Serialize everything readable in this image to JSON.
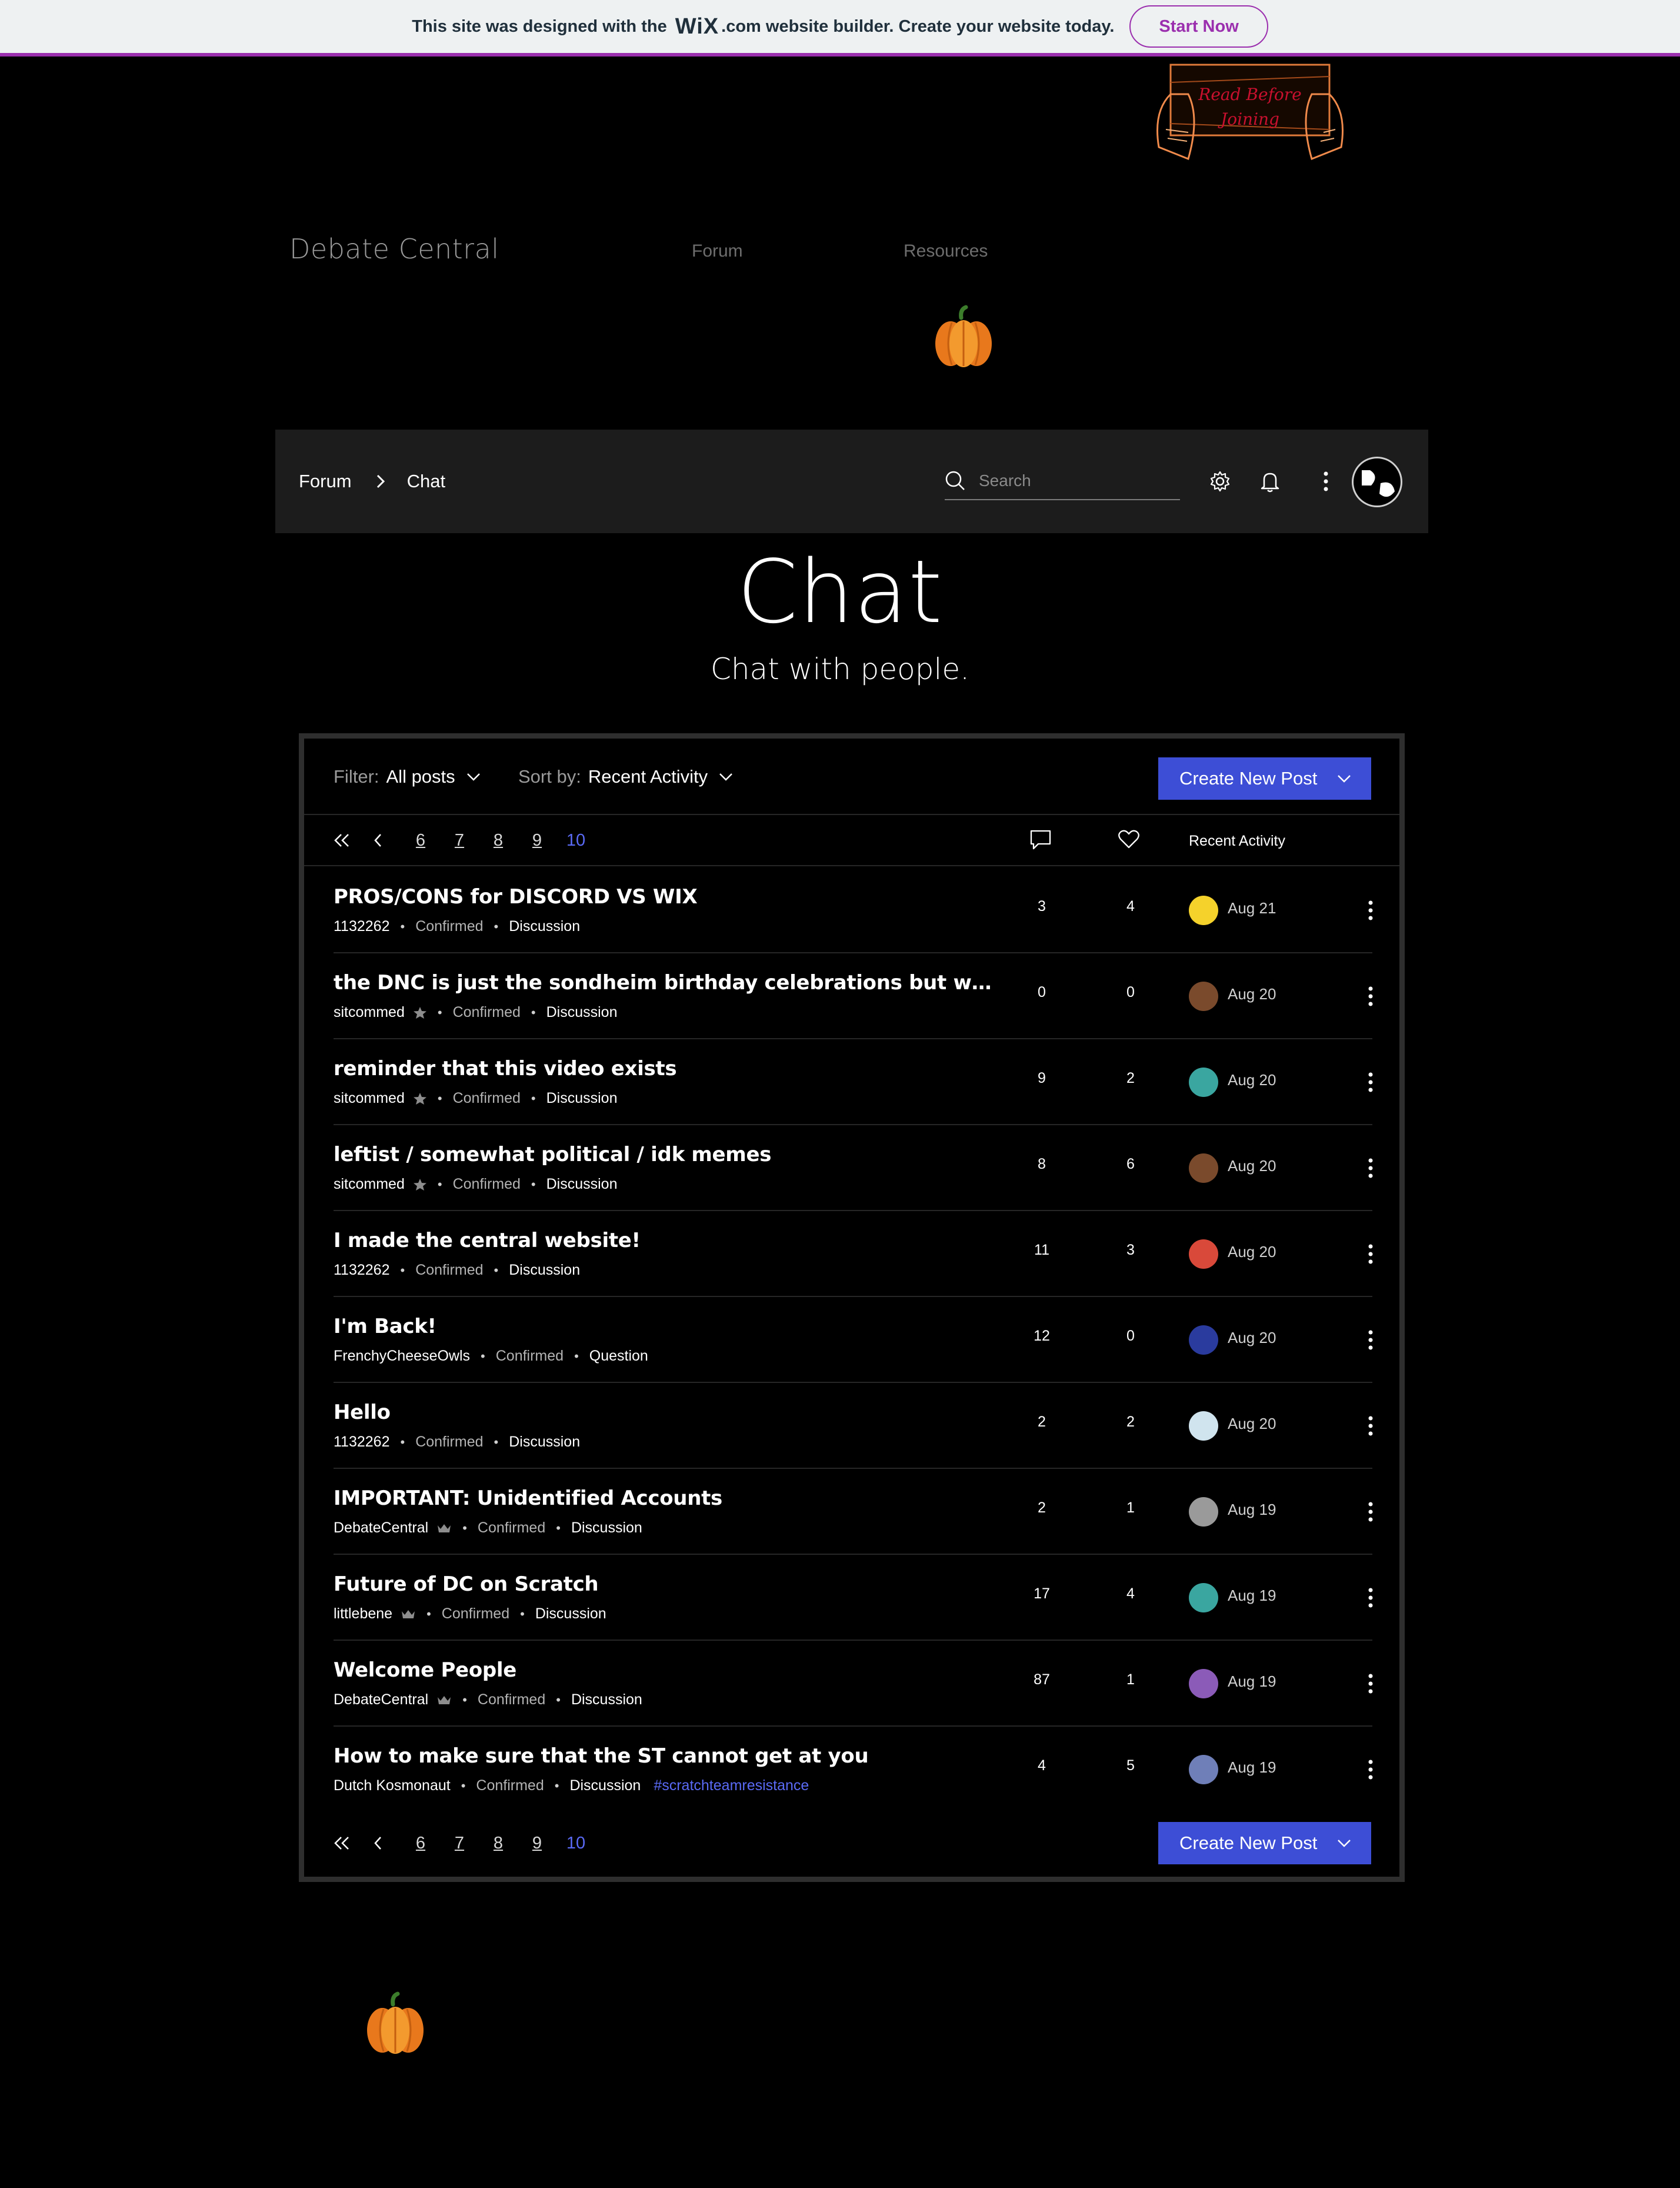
{
  "wix_banner": {
    "text_before": "This site was designed with the",
    "logo": "WiX",
    "text_after": ".com website builder. Create your website today.",
    "cta": "Start Now"
  },
  "header_art": {
    "line1": "Read Before",
    "line2": "Joining"
  },
  "site": {
    "title": "Debate Central",
    "nav": [
      "Forum",
      "Resources"
    ]
  },
  "forum_bar": {
    "breadcrumb": [
      "Forum",
      "Chat"
    ],
    "search_placeholder": "Search"
  },
  "category": {
    "title": "Chat",
    "subtitle": "Chat with people."
  },
  "toolbar": {
    "filter_label": "Filter:",
    "filter_value": "All posts",
    "sort_label": "Sort by:",
    "sort_value": "Recent Activity",
    "create_label": "Create New Post"
  },
  "pagination": {
    "pages": [
      "6",
      "7",
      "8",
      "9",
      "10"
    ],
    "current": "10"
  },
  "columns": {
    "recent_activity": "Recent Activity"
  },
  "posts": [
    {
      "title": "PROS/CONS for DISCORD VS WIX",
      "author": "1132262",
      "role_icon": "",
      "status": "Confirmed",
      "type": "Discussion",
      "tag": "",
      "comments": "3",
      "likes": "4",
      "date": "Aug 21",
      "avatar_color": "#f5d22b"
    },
    {
      "title": "the DNC is just the sondheim birthday celebrations but with more…",
      "author": "sitcommed",
      "role_icon": "star",
      "status": "Confirmed",
      "type": "Discussion",
      "tag": "",
      "comments": "0",
      "likes": "0",
      "date": "Aug 20",
      "avatar_color": "#7a4a2c"
    },
    {
      "title": "reminder that this video exists",
      "author": "sitcommed",
      "role_icon": "star",
      "status": "Confirmed",
      "type": "Discussion",
      "tag": "",
      "comments": "9",
      "likes": "2",
      "date": "Aug 20",
      "avatar_color": "#3aa6a0"
    },
    {
      "title": "leftist / somewhat political / idk memes",
      "author": "sitcommed",
      "role_icon": "star",
      "status": "Confirmed",
      "type": "Discussion",
      "tag": "",
      "comments": "8",
      "likes": "6",
      "date": "Aug 20",
      "avatar_color": "#7a4a2c"
    },
    {
      "title": "I made the central website!",
      "author": "1132262",
      "role_icon": "",
      "status": "Confirmed",
      "type": "Discussion",
      "tag": "",
      "comments": "11",
      "likes": "3",
      "date": "Aug 20",
      "avatar_color": "#d9493a"
    },
    {
      "title": "I'm Back!",
      "author": "FrenchyCheeseOwls",
      "role_icon": "",
      "status": "Confirmed",
      "type": "Question",
      "tag": "",
      "comments": "12",
      "likes": "0",
      "date": "Aug 20",
      "avatar_color": "#2a3b9e"
    },
    {
      "title": "Hello",
      "author": "1132262",
      "role_icon": "",
      "status": "Confirmed",
      "type": "Discussion",
      "tag": "",
      "comments": "2",
      "likes": "2",
      "date": "Aug 20",
      "avatar_color": "#d0e4ee"
    },
    {
      "title": "IMPORTANT: Unidentified Accounts",
      "author": "DebateCentral",
      "role_icon": "crown",
      "status": "Confirmed",
      "type": "Discussion",
      "tag": "",
      "comments": "2",
      "likes": "1",
      "date": "Aug 19",
      "avatar_color": "#9a9a9a"
    },
    {
      "title": "Future of DC on Scratch",
      "author": "littlebene",
      "role_icon": "crown",
      "status": "Confirmed",
      "type": "Discussion",
      "tag": "",
      "comments": "17",
      "likes": "4",
      "date": "Aug 19",
      "avatar_color": "#3aa6a0"
    },
    {
      "title": "Welcome People",
      "author": "DebateCentral",
      "role_icon": "crown",
      "status": "Confirmed",
      "type": "Discussion",
      "tag": "",
      "comments": "87",
      "likes": "1",
      "date": "Aug 19",
      "avatar_color": "#8b5bb8"
    },
    {
      "title": "How to make sure that the ST cannot get at you",
      "author": "Dutch Kosmonaut",
      "role_icon": "",
      "status": "Confirmed",
      "type": "Discussion",
      "tag": "#scratchteamresistance",
      "comments": "4",
      "likes": "5",
      "date": "Aug 19",
      "avatar_color": "#6f7fb8"
    }
  ],
  "colors": {
    "accent": "#3d4ed6",
    "link": "#5a6af5",
    "wix_purple": "#9b2fae"
  }
}
